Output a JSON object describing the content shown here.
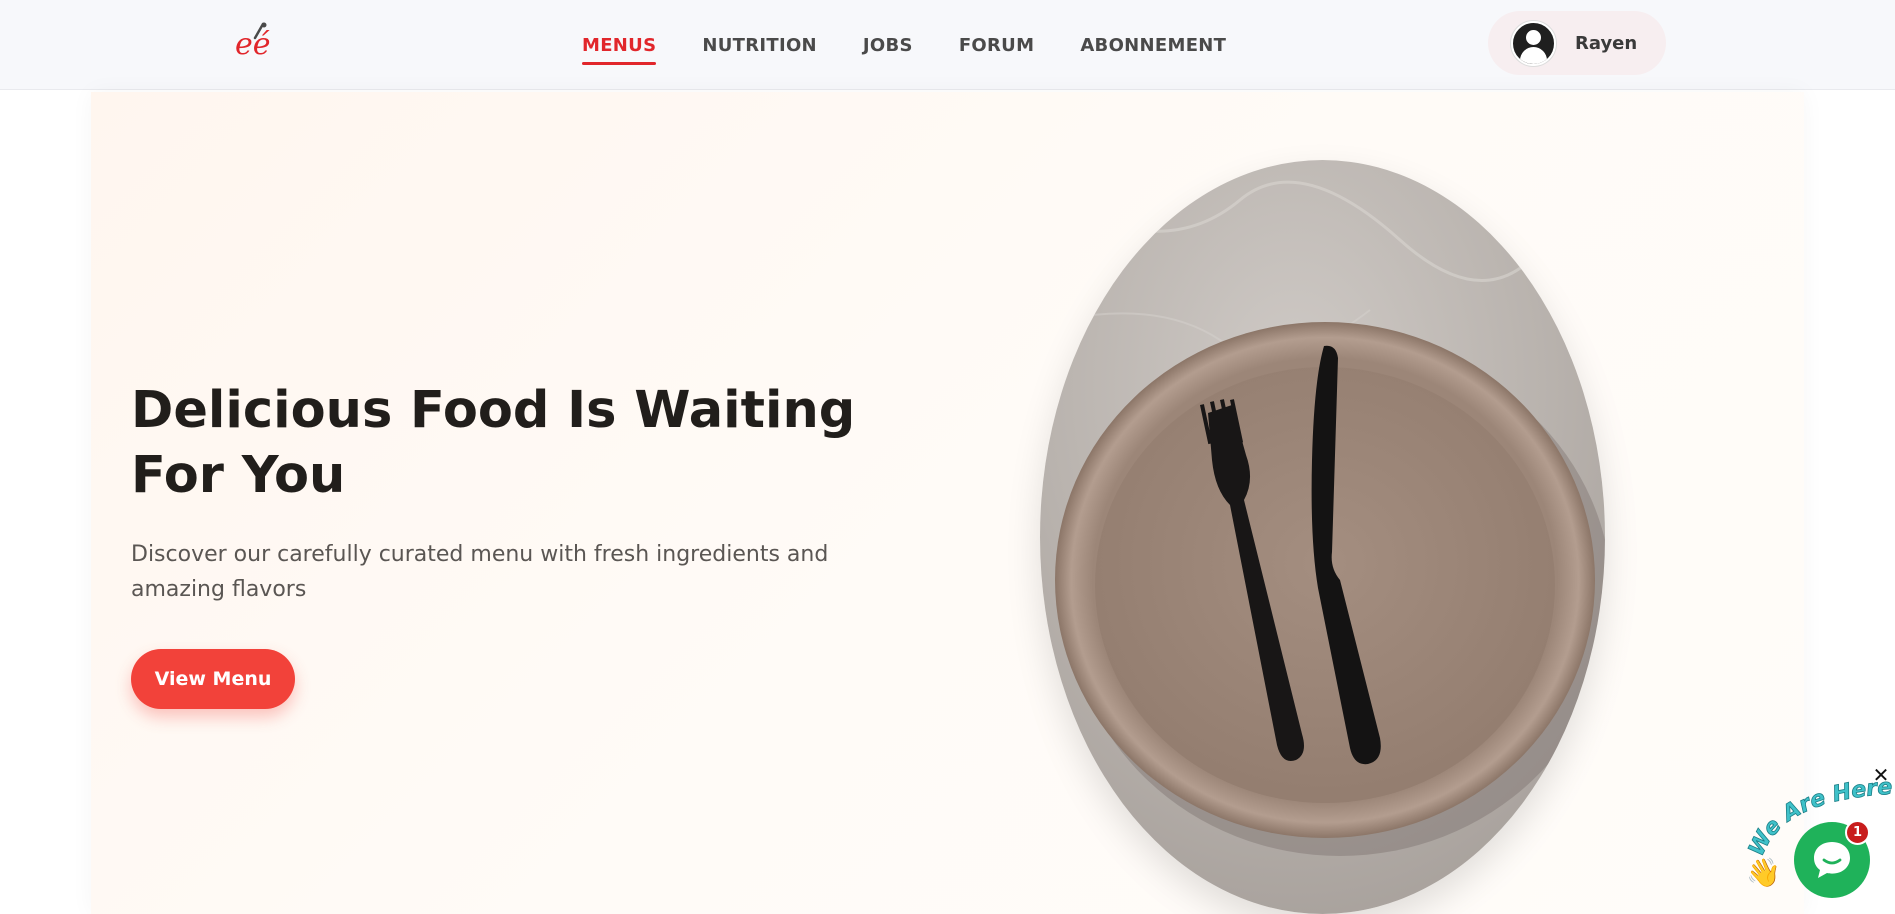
{
  "header": {
    "logo_text": "eé",
    "nav": [
      {
        "label": "MENUS",
        "active": true
      },
      {
        "label": "NUTRITION",
        "active": false
      },
      {
        "label": "JOBS",
        "active": false
      },
      {
        "label": "FORUM",
        "active": false
      },
      {
        "label": "ABONNEMENT",
        "active": false
      }
    ],
    "user": {
      "name": "Rayen"
    }
  },
  "hero": {
    "title_line1": "Delicious Food Is Waiting",
    "title_line2": "For You",
    "subtitle": "Discover our carefully curated menu with fresh ingredients and amazing flavors",
    "cta_label": "View Menu"
  },
  "chat": {
    "banner": "We Are Here!",
    "badge_count": "1",
    "close_glyph": "✕",
    "wave_glyph": "👋"
  },
  "colors": {
    "accent": "#e1262b",
    "cta": "#f2423a",
    "chat_green": "#1fb25a",
    "badge_red": "#c81d1d"
  }
}
